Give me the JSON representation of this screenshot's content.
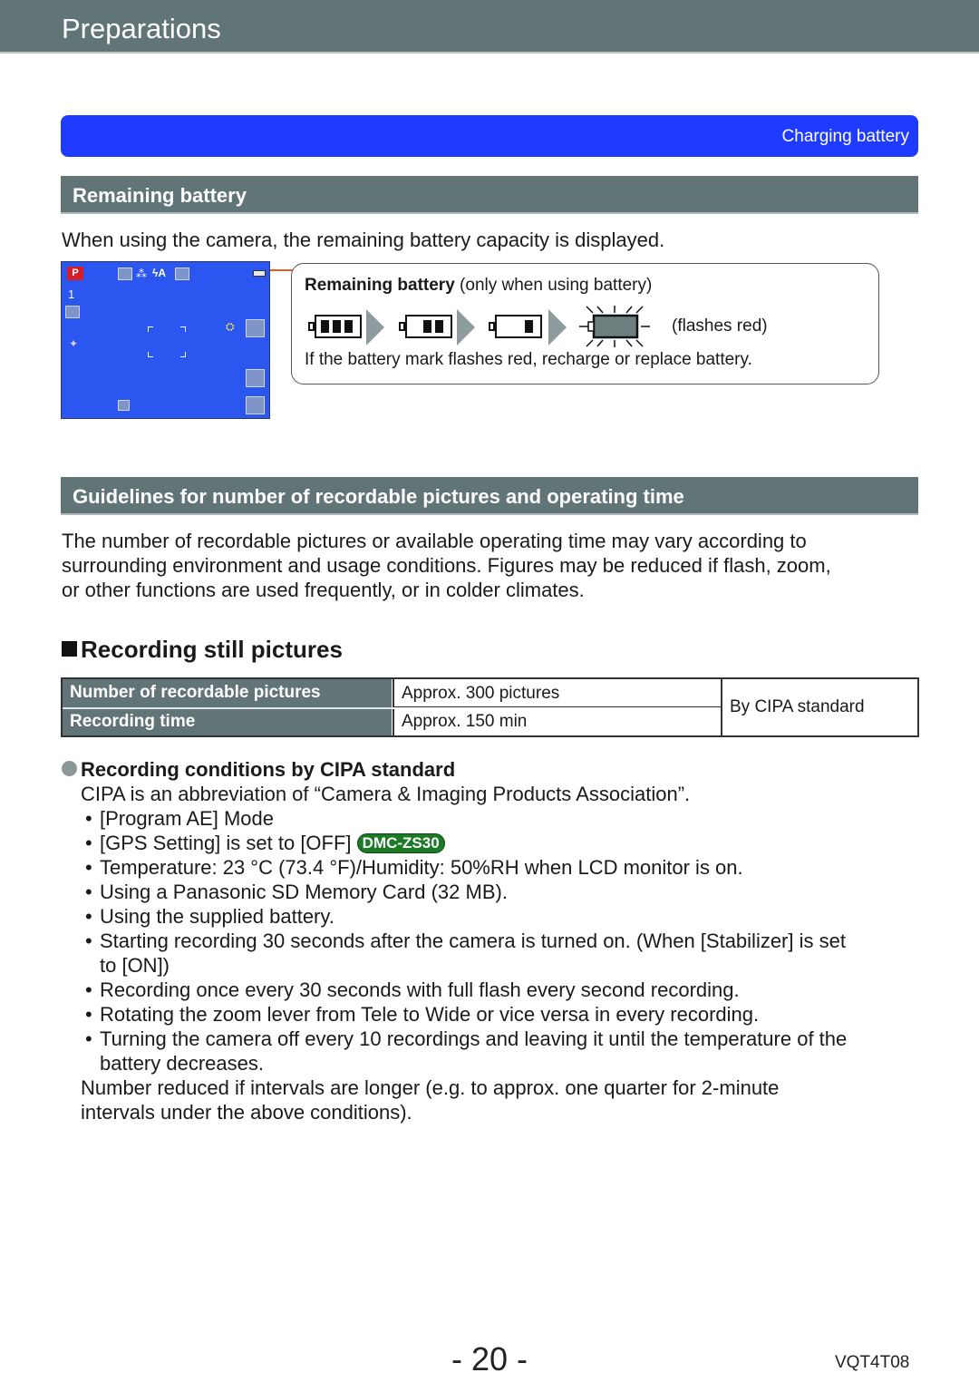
{
  "header": {
    "title": "Preparations"
  },
  "nav": {
    "link_label": "Charging battery",
    "bar_color": "#1f3bff"
  },
  "section1": {
    "heading": "Remaining battery",
    "intro": "When using the camera, the remaining battery capacity is displayed.",
    "camera_screen": {
      "mode_label": "P",
      "icons": [
        "mode-p-icon",
        "picture-size-icon",
        "quality-icon",
        "flash-auto-icon",
        "stabilizer-icon",
        "battery-icon",
        "burst-icon",
        "intelligent-resolution-icon",
        "af-area-icon",
        "gps-icon",
        "zoom-icon",
        "scene-icon",
        "wide-tele-icon",
        "display-icon"
      ],
      "burst_count": "1"
    },
    "callout": {
      "title_bold": "Remaining battery",
      "title_rest": " (only when using battery)",
      "levels": [
        {
          "name": "full",
          "cells": 3
        },
        {
          "name": "two-thirds",
          "cells": 2
        },
        {
          "name": "one-third",
          "cells": 1
        },
        {
          "name": "empty-flashing",
          "cells": 0
        }
      ],
      "flash_note": "(flashes red)",
      "warning": "If the battery mark flashes red, recharge or replace battery."
    }
  },
  "section2": {
    "heading": "Guidelines for number of recordable pictures and operating time",
    "paragraph": [
      "The number of recordable pictures or available operating time may vary according to",
      "surrounding environment and usage conditions. Figures may be reduced if flash, zoom,",
      "or other functions are used frequently, or in colder climates."
    ]
  },
  "recording": {
    "heading": "Recording still pictures",
    "table": {
      "rows": [
        {
          "label": "Number of recordable pictures",
          "value": "Approx. 300 pictures"
        },
        {
          "label": "Recording time",
          "value": "Approx. 150 min"
        }
      ],
      "note": "By CIPA standard"
    },
    "conditions": {
      "heading": "Recording conditions by CIPA standard",
      "intro": "CIPA is an abbreviation of “Camera & Imaging Products Association”.",
      "items": [
        "[Program AE] Mode",
        "[GPS Setting] is set to [OFF]",
        "Temperature: 23 °C (73.4 °F)/Humidity: 50%RH when LCD monitor is on.",
        "Using a Panasonic SD Memory Card (32 MB).",
        "Using the supplied battery.",
        "Starting recording 30 seconds after the camera is turned on. (When [Stabilizer] is set",
        "to [ON])",
        "Recording once every 30 seconds with full flash every second recording.",
        "Rotating the zoom lever from Tele to Wide or vice versa in every recording.",
        "Turning the camera off every 10 recordings and leaving it until the temperature of the",
        "battery decreases."
      ],
      "model_badge": "DMC-ZS30",
      "footer": [
        "Number reduced if intervals are longer (e.g. to approx. one quarter for 2-minute",
        "intervals under the above conditions)."
      ]
    }
  },
  "footer": {
    "page_number": "- 20 -",
    "doc_code": "VQT4T08"
  }
}
